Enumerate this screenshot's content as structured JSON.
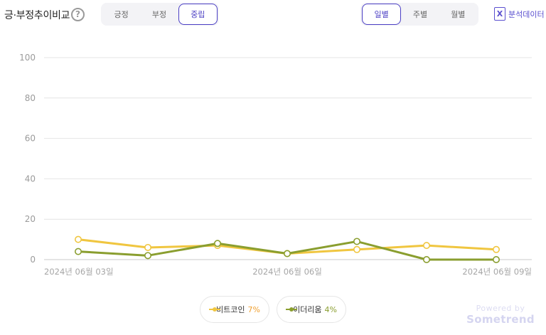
{
  "header": {
    "title": "긍·부정추이비교",
    "help_symbol": "?",
    "sentiment_tabs": [
      {
        "label": "긍정",
        "active": false
      },
      {
        "label": "부정",
        "active": false
      },
      {
        "label": "중립",
        "active": true
      }
    ],
    "period_tabs": [
      {
        "label": "일별",
        "active": true
      },
      {
        "label": "주별",
        "active": false
      },
      {
        "label": "월별",
        "active": false
      }
    ],
    "export": {
      "icon_letter": "X",
      "label": "분석데이터"
    }
  },
  "chart_data": {
    "type": "line",
    "x": [
      "2024년 06월 03일",
      "2024년 06월 04일",
      "2024년 06월 05일",
      "2024년 06월 06일",
      "2024년 06월 07일",
      "2024년 06월 08일",
      "2024년 06월 09일"
    ],
    "x_tick_labels": [
      "2024년 06월 03일",
      "2024년 06월 06일",
      "2024년 06월 09일"
    ],
    "series": [
      {
        "name": "비트코인",
        "color": "#f0c640",
        "values": [
          10,
          6,
          7,
          3,
          5,
          7,
          5
        ]
      },
      {
        "name": "이더리움",
        "color": "#8a9e2f",
        "values": [
          4,
          2,
          8,
          3,
          9,
          0,
          0
        ]
      }
    ],
    "ylim": [
      0,
      100
    ],
    "yticks": [
      0,
      20,
      40,
      60,
      80,
      100
    ],
    "grid": true,
    "legend_position": "bottom-center"
  },
  "legend": [
    {
      "name": "비트코인",
      "pct": "7%",
      "color": "#f0c640",
      "pct_color": "#f0a030"
    },
    {
      "name": "이더리움",
      "pct": "4%",
      "color": "#8a9e2f",
      "pct_color": "#8a9e2f"
    }
  ],
  "footer": {
    "powered_by": "Powered by",
    "brand": "Sometrend"
  }
}
